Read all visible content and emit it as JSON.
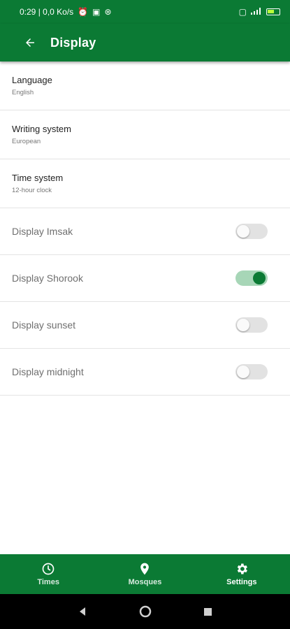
{
  "status_bar": {
    "time_network": "0:29 | 0,0 Ko/s"
  },
  "app_bar": {
    "title": "Display"
  },
  "settings": [
    {
      "title": "Language",
      "value": "English"
    },
    {
      "title": "Writing system",
      "value": "European"
    },
    {
      "title": "Time system",
      "value": "12-hour clock"
    }
  ],
  "toggles": [
    {
      "label": "Display Imsak",
      "on": false
    },
    {
      "label": "Display Shorook",
      "on": true
    },
    {
      "label": "Display sunset",
      "on": false
    },
    {
      "label": "Display midnight",
      "on": false
    }
  ],
  "bottom_nav": {
    "items": [
      {
        "label": "Times",
        "icon": "clock-icon"
      },
      {
        "label": "Mosques",
        "icon": "location-pin-icon"
      },
      {
        "label": "Settings",
        "icon": "gear-icon",
        "active": true
      }
    ]
  },
  "colors": {
    "primary": "#0b7a34",
    "switch_on_track": "#a7d6b7",
    "switch_off_track": "#e2e2e2"
  }
}
